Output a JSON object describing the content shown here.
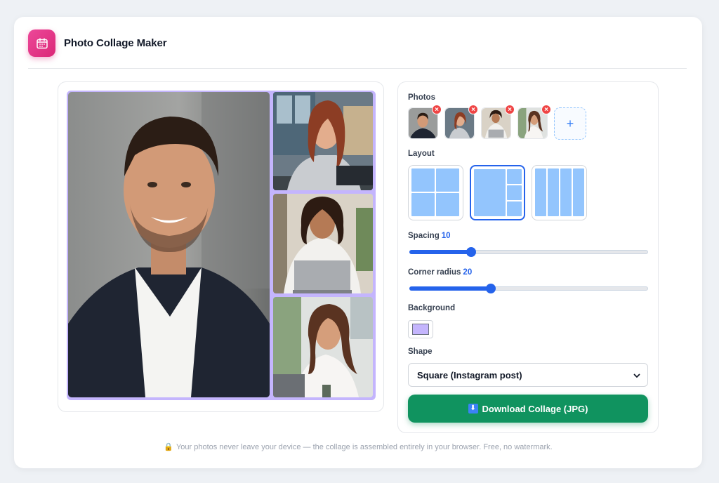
{
  "app": {
    "title": "Photo Collage Maker",
    "icon": "calendar-icon",
    "accent": "#db2777"
  },
  "preview": {
    "background_color": "#c4b5fd",
    "tiles": [
      "photo-man-suit",
      "photo-woman-laptop-red-hair",
      "photo-woman-laptop-curly",
      "photo-woman-laptop-wavy"
    ]
  },
  "controls": {
    "photos": {
      "label": "Photos",
      "items": [
        {
          "name": "man-suit"
        },
        {
          "name": "woman-laptop-red-hair"
        },
        {
          "name": "woman-laptop-curly"
        },
        {
          "name": "woman-laptop-wavy"
        }
      ],
      "remove_glyph": "×",
      "add_glyph": "+"
    },
    "layout": {
      "label": "Layout",
      "options": [
        "grid-2x2",
        "one-plus-three",
        "four-columns"
      ],
      "selected": "one-plus-three"
    },
    "spacing": {
      "label": "Spacing",
      "value": "10",
      "fraction": 0.26
    },
    "corner_radius": {
      "label": "Corner radius",
      "value": "20",
      "fraction": 0.34
    },
    "background": {
      "label": "Background",
      "color": "#c4b5fd"
    },
    "shape": {
      "label": "Shape",
      "selected": "Square (Instagram post)"
    },
    "download": {
      "label": "Download Collage (JPG)",
      "icon_glyph": "⬇",
      "color": "#10935f"
    }
  },
  "footer": {
    "lock_glyph": "🔒",
    "note": "Your photos never leave your device — the collage is assembled entirely in your browser. Free, no watermark."
  }
}
